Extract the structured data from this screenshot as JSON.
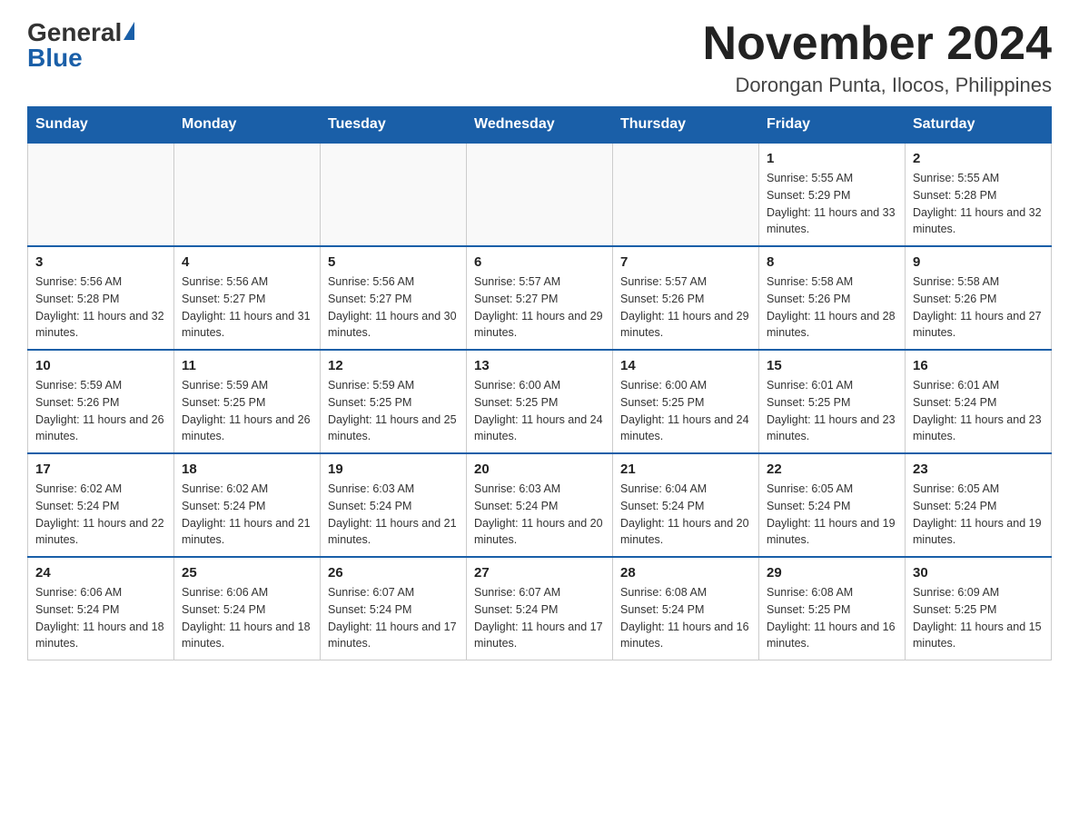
{
  "logo": {
    "general": "General",
    "blue": "Blue"
  },
  "title": "November 2024",
  "subtitle": "Dorongan Punta, Ilocos, Philippines",
  "days_of_week": [
    "Sunday",
    "Monday",
    "Tuesday",
    "Wednesday",
    "Thursday",
    "Friday",
    "Saturday"
  ],
  "weeks": [
    [
      {
        "day": "",
        "sunrise": "",
        "sunset": "",
        "daylight": ""
      },
      {
        "day": "",
        "sunrise": "",
        "sunset": "",
        "daylight": ""
      },
      {
        "day": "",
        "sunrise": "",
        "sunset": "",
        "daylight": ""
      },
      {
        "day": "",
        "sunrise": "",
        "sunset": "",
        "daylight": ""
      },
      {
        "day": "",
        "sunrise": "",
        "sunset": "",
        "daylight": ""
      },
      {
        "day": "1",
        "sunrise": "Sunrise: 5:55 AM",
        "sunset": "Sunset: 5:29 PM",
        "daylight": "Daylight: 11 hours and 33 minutes."
      },
      {
        "day": "2",
        "sunrise": "Sunrise: 5:55 AM",
        "sunset": "Sunset: 5:28 PM",
        "daylight": "Daylight: 11 hours and 32 minutes."
      }
    ],
    [
      {
        "day": "3",
        "sunrise": "Sunrise: 5:56 AM",
        "sunset": "Sunset: 5:28 PM",
        "daylight": "Daylight: 11 hours and 32 minutes."
      },
      {
        "day": "4",
        "sunrise": "Sunrise: 5:56 AM",
        "sunset": "Sunset: 5:27 PM",
        "daylight": "Daylight: 11 hours and 31 minutes."
      },
      {
        "day": "5",
        "sunrise": "Sunrise: 5:56 AM",
        "sunset": "Sunset: 5:27 PM",
        "daylight": "Daylight: 11 hours and 30 minutes."
      },
      {
        "day": "6",
        "sunrise": "Sunrise: 5:57 AM",
        "sunset": "Sunset: 5:27 PM",
        "daylight": "Daylight: 11 hours and 29 minutes."
      },
      {
        "day": "7",
        "sunrise": "Sunrise: 5:57 AM",
        "sunset": "Sunset: 5:26 PM",
        "daylight": "Daylight: 11 hours and 29 minutes."
      },
      {
        "day": "8",
        "sunrise": "Sunrise: 5:58 AM",
        "sunset": "Sunset: 5:26 PM",
        "daylight": "Daylight: 11 hours and 28 minutes."
      },
      {
        "day": "9",
        "sunrise": "Sunrise: 5:58 AM",
        "sunset": "Sunset: 5:26 PM",
        "daylight": "Daylight: 11 hours and 27 minutes."
      }
    ],
    [
      {
        "day": "10",
        "sunrise": "Sunrise: 5:59 AM",
        "sunset": "Sunset: 5:26 PM",
        "daylight": "Daylight: 11 hours and 26 minutes."
      },
      {
        "day": "11",
        "sunrise": "Sunrise: 5:59 AM",
        "sunset": "Sunset: 5:25 PM",
        "daylight": "Daylight: 11 hours and 26 minutes."
      },
      {
        "day": "12",
        "sunrise": "Sunrise: 5:59 AM",
        "sunset": "Sunset: 5:25 PM",
        "daylight": "Daylight: 11 hours and 25 minutes."
      },
      {
        "day": "13",
        "sunrise": "Sunrise: 6:00 AM",
        "sunset": "Sunset: 5:25 PM",
        "daylight": "Daylight: 11 hours and 24 minutes."
      },
      {
        "day": "14",
        "sunrise": "Sunrise: 6:00 AM",
        "sunset": "Sunset: 5:25 PM",
        "daylight": "Daylight: 11 hours and 24 minutes."
      },
      {
        "day": "15",
        "sunrise": "Sunrise: 6:01 AM",
        "sunset": "Sunset: 5:25 PM",
        "daylight": "Daylight: 11 hours and 23 minutes."
      },
      {
        "day": "16",
        "sunrise": "Sunrise: 6:01 AM",
        "sunset": "Sunset: 5:24 PM",
        "daylight": "Daylight: 11 hours and 23 minutes."
      }
    ],
    [
      {
        "day": "17",
        "sunrise": "Sunrise: 6:02 AM",
        "sunset": "Sunset: 5:24 PM",
        "daylight": "Daylight: 11 hours and 22 minutes."
      },
      {
        "day": "18",
        "sunrise": "Sunrise: 6:02 AM",
        "sunset": "Sunset: 5:24 PM",
        "daylight": "Daylight: 11 hours and 21 minutes."
      },
      {
        "day": "19",
        "sunrise": "Sunrise: 6:03 AM",
        "sunset": "Sunset: 5:24 PM",
        "daylight": "Daylight: 11 hours and 21 minutes."
      },
      {
        "day": "20",
        "sunrise": "Sunrise: 6:03 AM",
        "sunset": "Sunset: 5:24 PM",
        "daylight": "Daylight: 11 hours and 20 minutes."
      },
      {
        "day": "21",
        "sunrise": "Sunrise: 6:04 AM",
        "sunset": "Sunset: 5:24 PM",
        "daylight": "Daylight: 11 hours and 20 minutes."
      },
      {
        "day": "22",
        "sunrise": "Sunrise: 6:05 AM",
        "sunset": "Sunset: 5:24 PM",
        "daylight": "Daylight: 11 hours and 19 minutes."
      },
      {
        "day": "23",
        "sunrise": "Sunrise: 6:05 AM",
        "sunset": "Sunset: 5:24 PM",
        "daylight": "Daylight: 11 hours and 19 minutes."
      }
    ],
    [
      {
        "day": "24",
        "sunrise": "Sunrise: 6:06 AM",
        "sunset": "Sunset: 5:24 PM",
        "daylight": "Daylight: 11 hours and 18 minutes."
      },
      {
        "day": "25",
        "sunrise": "Sunrise: 6:06 AM",
        "sunset": "Sunset: 5:24 PM",
        "daylight": "Daylight: 11 hours and 18 minutes."
      },
      {
        "day": "26",
        "sunrise": "Sunrise: 6:07 AM",
        "sunset": "Sunset: 5:24 PM",
        "daylight": "Daylight: 11 hours and 17 minutes."
      },
      {
        "day": "27",
        "sunrise": "Sunrise: 6:07 AM",
        "sunset": "Sunset: 5:24 PM",
        "daylight": "Daylight: 11 hours and 17 minutes."
      },
      {
        "day": "28",
        "sunrise": "Sunrise: 6:08 AM",
        "sunset": "Sunset: 5:24 PM",
        "daylight": "Daylight: 11 hours and 16 minutes."
      },
      {
        "day": "29",
        "sunrise": "Sunrise: 6:08 AM",
        "sunset": "Sunset: 5:25 PM",
        "daylight": "Daylight: 11 hours and 16 minutes."
      },
      {
        "day": "30",
        "sunrise": "Sunrise: 6:09 AM",
        "sunset": "Sunset: 5:25 PM",
        "daylight": "Daylight: 11 hours and 15 minutes."
      }
    ]
  ]
}
